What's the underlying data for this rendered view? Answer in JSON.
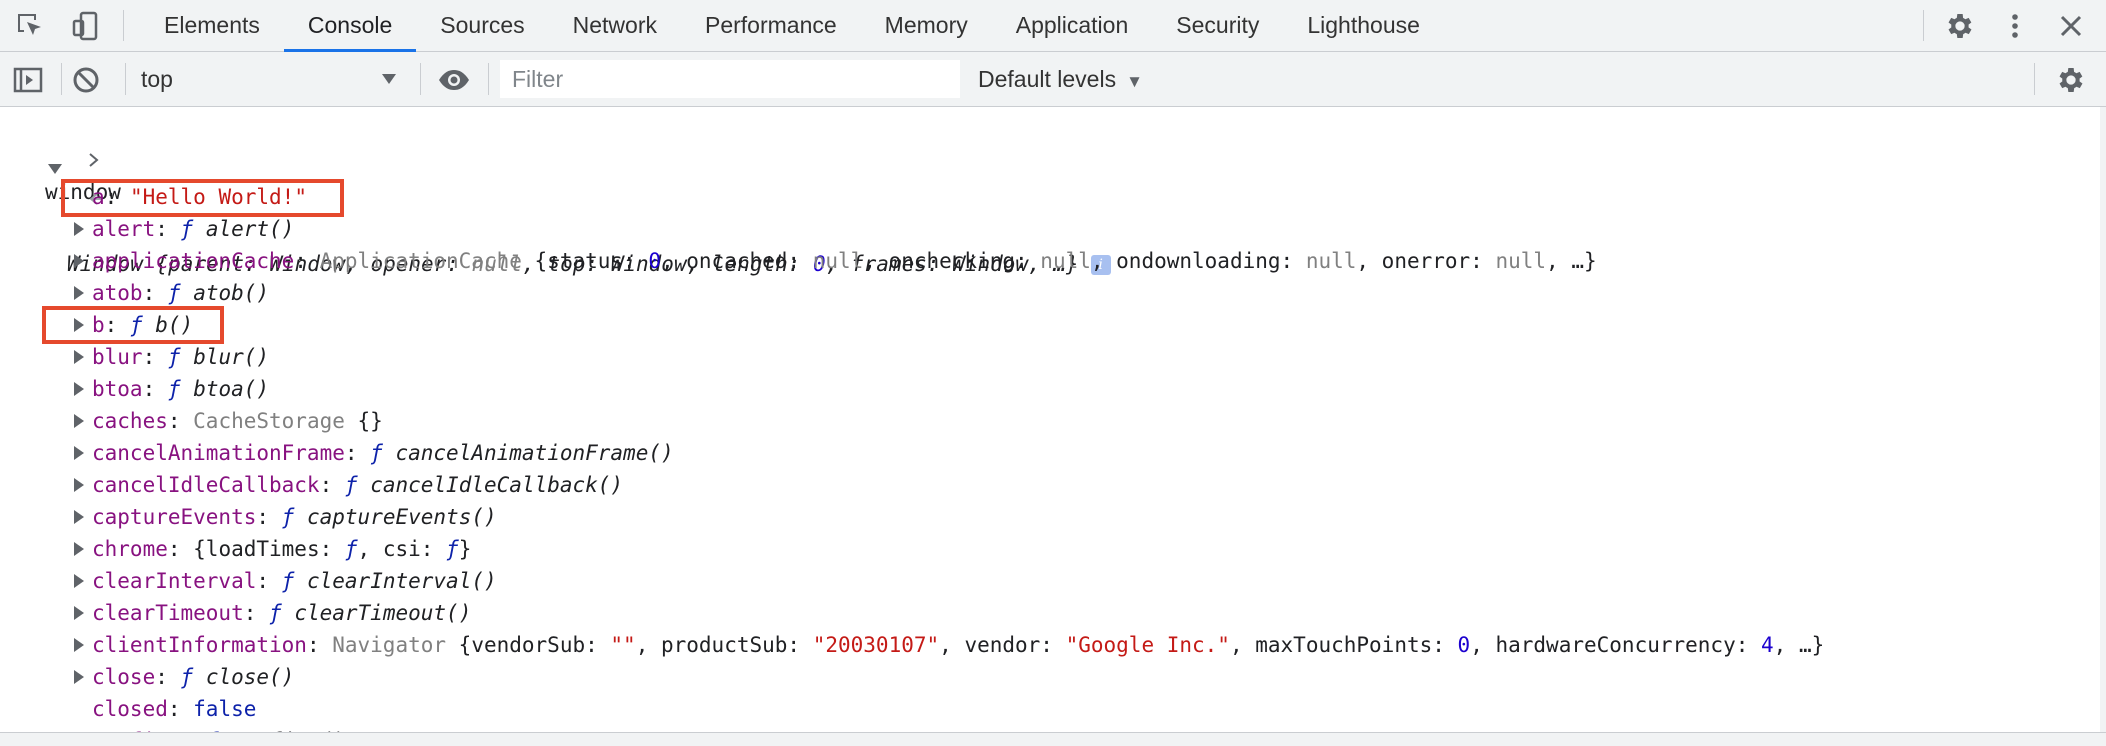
{
  "tabs": [
    "Elements",
    "Console",
    "Sources",
    "Network",
    "Performance",
    "Memory",
    "Application",
    "Security",
    "Lighthouse"
  ],
  "active_tab": "Console",
  "toolbar": {
    "context": "top",
    "filter_placeholder": "Filter",
    "filter_value": "",
    "levels_label": "Default levels"
  },
  "console": {
    "input_command": "window",
    "window_summary": {
      "class": "Window",
      "fields": [
        {
          "key": "parent",
          "value": "Window",
          "type": "obj"
        },
        {
          "key": "opener",
          "value": "null",
          "type": "null"
        },
        {
          "key": "top",
          "value": "Window",
          "type": "obj"
        },
        {
          "key": "length",
          "value": "0",
          "type": "num"
        },
        {
          "key": "frames",
          "value": "Window",
          "type": "obj"
        }
      ],
      "ellipsis": "…"
    },
    "properties": [
      {
        "key": "a",
        "expandable": false,
        "highlight": true,
        "parts": [
          [
            "s",
            "\"Hello World!\""
          ]
        ]
      },
      {
        "key": "alert",
        "expandable": true,
        "parts": [
          [
            "f",
            "ƒ"
          ],
          [
            "t",
            " "
          ],
          [
            "fn",
            "alert()"
          ]
        ]
      },
      {
        "key": "applicationCache",
        "expandable": true,
        "parts": [
          [
            "cls",
            "ApplicationCache"
          ],
          [
            "t",
            " {status: "
          ],
          [
            "n",
            "0"
          ],
          [
            "t",
            ", oncached: "
          ],
          [
            "nl",
            "null"
          ],
          [
            "t",
            ", onchecking: "
          ],
          [
            "nl",
            "null"
          ],
          [
            "t",
            ", ondownloading: "
          ],
          [
            "nl",
            "null"
          ],
          [
            "t",
            ", onerror: "
          ],
          [
            "nl",
            "null"
          ],
          [
            "t",
            ", …}"
          ]
        ]
      },
      {
        "key": "atob",
        "expandable": true,
        "parts": [
          [
            "f",
            "ƒ"
          ],
          [
            "t",
            " "
          ],
          [
            "fn",
            "atob()"
          ]
        ]
      },
      {
        "key": "b",
        "expandable": true,
        "highlight": true,
        "parts": [
          [
            "f",
            "ƒ"
          ],
          [
            "t",
            " "
          ],
          [
            "fn",
            "b()"
          ]
        ]
      },
      {
        "key": "blur",
        "expandable": true,
        "parts": [
          [
            "f",
            "ƒ"
          ],
          [
            "t",
            " "
          ],
          [
            "fn",
            "blur()"
          ]
        ]
      },
      {
        "key": "btoa",
        "expandable": true,
        "parts": [
          [
            "f",
            "ƒ"
          ],
          [
            "t",
            " "
          ],
          [
            "fn",
            "btoa()"
          ]
        ]
      },
      {
        "key": "caches",
        "expandable": true,
        "parts": [
          [
            "cls",
            "CacheStorage"
          ],
          [
            "t",
            " {}"
          ]
        ]
      },
      {
        "key": "cancelAnimationFrame",
        "expandable": true,
        "parts": [
          [
            "f",
            "ƒ"
          ],
          [
            "t",
            " "
          ],
          [
            "fn",
            "cancelAnimationFrame()"
          ]
        ]
      },
      {
        "key": "cancelIdleCallback",
        "expandable": true,
        "parts": [
          [
            "f",
            "ƒ"
          ],
          [
            "t",
            " "
          ],
          [
            "fn",
            "cancelIdleCallback()"
          ]
        ]
      },
      {
        "key": "captureEvents",
        "expandable": true,
        "parts": [
          [
            "f",
            "ƒ"
          ],
          [
            "t",
            " "
          ],
          [
            "fn",
            "captureEvents()"
          ]
        ]
      },
      {
        "key": "chrome",
        "expandable": true,
        "parts": [
          [
            "t",
            "{loadTimes: "
          ],
          [
            "f",
            "ƒ"
          ],
          [
            "t",
            ", csi: "
          ],
          [
            "f",
            "ƒ"
          ],
          [
            "t",
            "}"
          ]
        ]
      },
      {
        "key": "clearInterval",
        "expandable": true,
        "parts": [
          [
            "f",
            "ƒ"
          ],
          [
            "t",
            " "
          ],
          [
            "fn",
            "clearInterval()"
          ]
        ]
      },
      {
        "key": "clearTimeout",
        "expandable": true,
        "parts": [
          [
            "f",
            "ƒ"
          ],
          [
            "t",
            " "
          ],
          [
            "fn",
            "clearTimeout()"
          ]
        ]
      },
      {
        "key": "clientInformation",
        "expandable": true,
        "parts": [
          [
            "cls",
            "Navigator"
          ],
          [
            "t",
            " {vendorSub: "
          ],
          [
            "s",
            "\"\""
          ],
          [
            "t",
            ", productSub: "
          ],
          [
            "s",
            "\"20030107\""
          ],
          [
            "t",
            ", vendor: "
          ],
          [
            "s",
            "\"Google Inc.\""
          ],
          [
            "t",
            ", maxTouchPoints: "
          ],
          [
            "n",
            "0"
          ],
          [
            "t",
            ", hardwareConcurrency: "
          ],
          [
            "n",
            "4"
          ],
          [
            "t",
            ", …}"
          ]
        ]
      },
      {
        "key": "close",
        "expandable": true,
        "parts": [
          [
            "f",
            "ƒ"
          ],
          [
            "t",
            " "
          ],
          [
            "fn",
            "close()"
          ]
        ]
      },
      {
        "key": "closed",
        "expandable": false,
        "parts": [
          [
            "kw",
            "false"
          ]
        ]
      },
      {
        "key": "confirm",
        "expandable": true,
        "parts": [
          [
            "f",
            "ƒ"
          ],
          [
            "t",
            " "
          ],
          [
            "fn",
            "confirm()"
          ]
        ]
      }
    ]
  }
}
